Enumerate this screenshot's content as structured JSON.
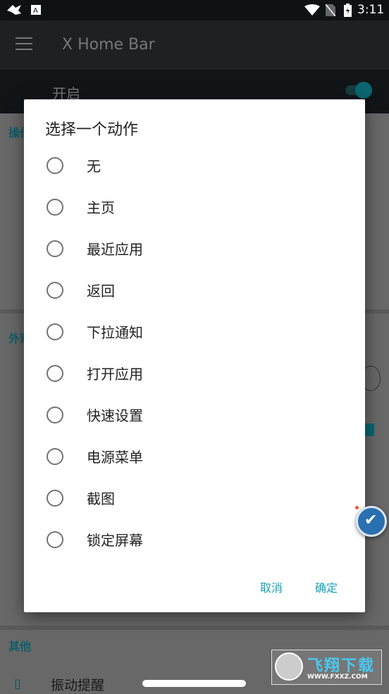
{
  "status_bar": {
    "time": "3:11",
    "icons": [
      "cleaner-icon",
      "keyboard-a-icon",
      "wifi-icon",
      "no-sim-icon",
      "battery-charging-icon"
    ]
  },
  "app_bar": {
    "title": "X Home Bar",
    "menu_icon": "hamburger-icon"
  },
  "enable_row": {
    "label": "开启",
    "toggle_on": true
  },
  "background": {
    "section_1_partial": "操作",
    "section_2_partial": "外观",
    "section_3": "其他",
    "vibrate_label": "振动提醒"
  },
  "dialog": {
    "title": "选择一个动作",
    "options": [
      "无",
      "主页",
      "最近应用",
      "返回",
      "下拉通知",
      "打开应用",
      "快速设置",
      "电源菜单",
      "截图",
      "锁定屏幕"
    ],
    "cancel": "取消",
    "ok": "确定"
  },
  "watermark": {
    "text": "飞翔下载",
    "url": "WWW.FXXZ.COM"
  },
  "colors": {
    "accent": "#17a2b5",
    "toggle": "#0b6672"
  }
}
